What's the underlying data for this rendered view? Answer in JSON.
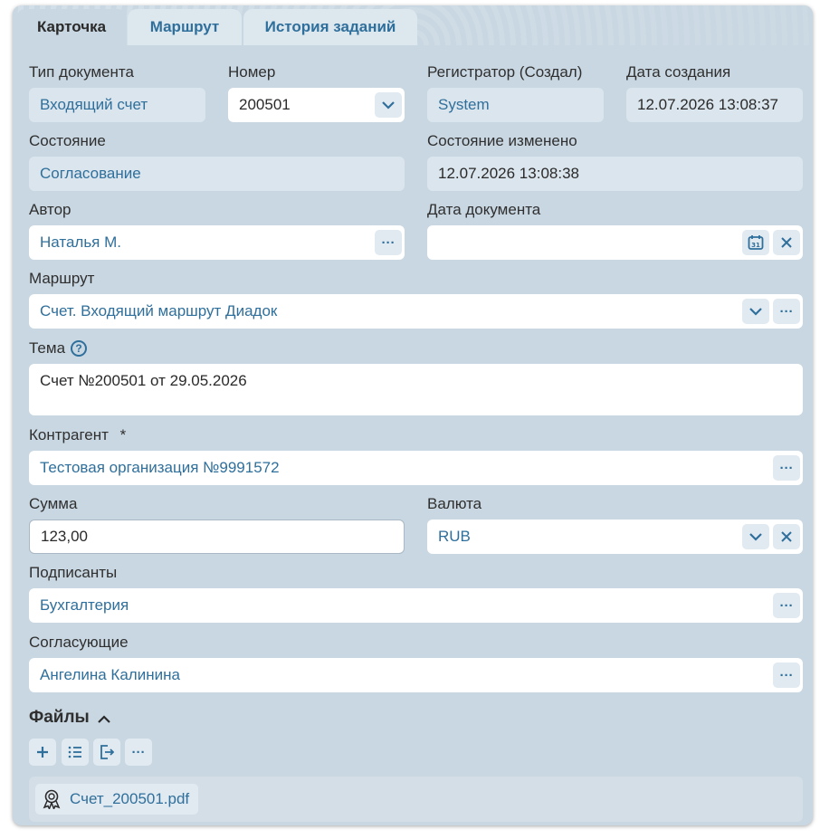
{
  "tabs": [
    {
      "label": "Карточка",
      "active": true
    },
    {
      "label": "Маршрут",
      "active": false
    },
    {
      "label": "История заданий",
      "active": false
    }
  ],
  "doc_type": {
    "label": "Тип документа",
    "value": "Входящий счет"
  },
  "number": {
    "label": "Номер",
    "value": "200501"
  },
  "registrar": {
    "label": "Регистратор (Создал)",
    "value": "System"
  },
  "created": {
    "label": "Дата создания",
    "value": "12.07.2026 13:08:37"
  },
  "state": {
    "label": "Состояние",
    "value": "Согласование"
  },
  "state_changed": {
    "label": "Состояние изменено",
    "value": "12.07.2026 13:08:38"
  },
  "author": {
    "label": "Автор",
    "value": "Наталья М."
  },
  "doc_date": {
    "label": "Дата документа",
    "value": ""
  },
  "route": {
    "label": "Маршрут",
    "value": "Счет. Входящий маршрут Диадок"
  },
  "subject": {
    "label": "Тема",
    "help": "?",
    "value": "Счет №200501 от 29.05.2026"
  },
  "counterparty": {
    "label": "Контрагент",
    "required_mark": "*",
    "value": "Тестовая организация №9991572"
  },
  "amount": {
    "label": "Сумма",
    "value": "123,00"
  },
  "currency": {
    "label": "Валюта",
    "value": "RUB"
  },
  "signers": {
    "label": "Подписанты",
    "value": "Бухгалтерия"
  },
  "approvers": {
    "label": "Согласующие",
    "value": "Ангелина Калинина"
  },
  "files": {
    "title": "Файлы",
    "items": [
      {
        "name": "Счет_200501.pdf"
      }
    ]
  },
  "icons": {
    "more": "ellipsis-icon",
    "dropdown": "chevron-down-icon",
    "calendar": "calendar-icon",
    "clear": "close-icon",
    "collapse": "chevron-up-icon",
    "add": "plus-icon",
    "list": "list-icon",
    "export": "export-icon",
    "file": "certificate-icon"
  },
  "colors": {
    "accent": "#2f6f9b",
    "card_bg": "#c9d7e2",
    "readonly_bg": "#dbe5ed"
  }
}
